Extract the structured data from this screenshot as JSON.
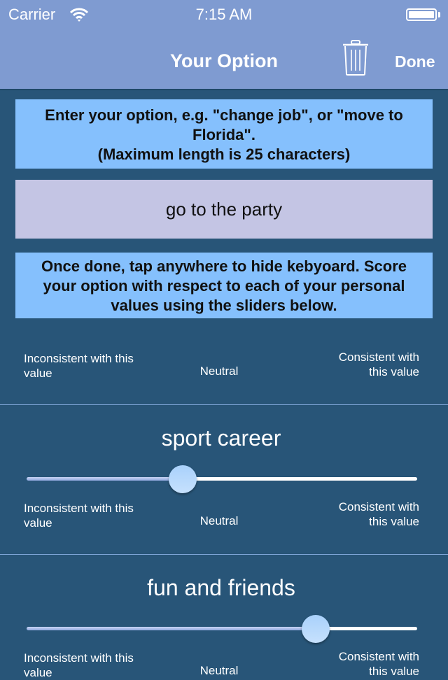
{
  "status_bar": {
    "carrier": "Carrier",
    "time": "7:15 AM",
    "wifi_icon": "wifi-icon",
    "battery_icon": "battery-icon",
    "battery_level": 1.0
  },
  "nav_bar": {
    "title": "Your Option",
    "trash_icon": "trash-icon",
    "done_label": "Done"
  },
  "instructions_top": {
    "line1": "Enter your option, e.g. \"change job\", or \"move to Florida\".",
    "line2": "(Maximum length is 25 characters)"
  },
  "option_input": {
    "value": "go to the party"
  },
  "instructions_bottom": {
    "text": "Once done, tap anywhere to hide kebyoard. Score your option with respect to each of your personal values using the sliders below."
  },
  "scale_labels": {
    "left": "Inconsistent with this value",
    "middle": "Neutral",
    "right": "Consistent with this value"
  },
  "values": [
    {
      "name": "sport career",
      "score": 0.4
    },
    {
      "name": "fun and friends",
      "score": 0.74
    }
  ],
  "colors": {
    "nav_bg": "#7f9bd1",
    "page_bg": "#285578",
    "instruction_bg": "#85c0fd",
    "input_bg": "#c4c5e4"
  }
}
